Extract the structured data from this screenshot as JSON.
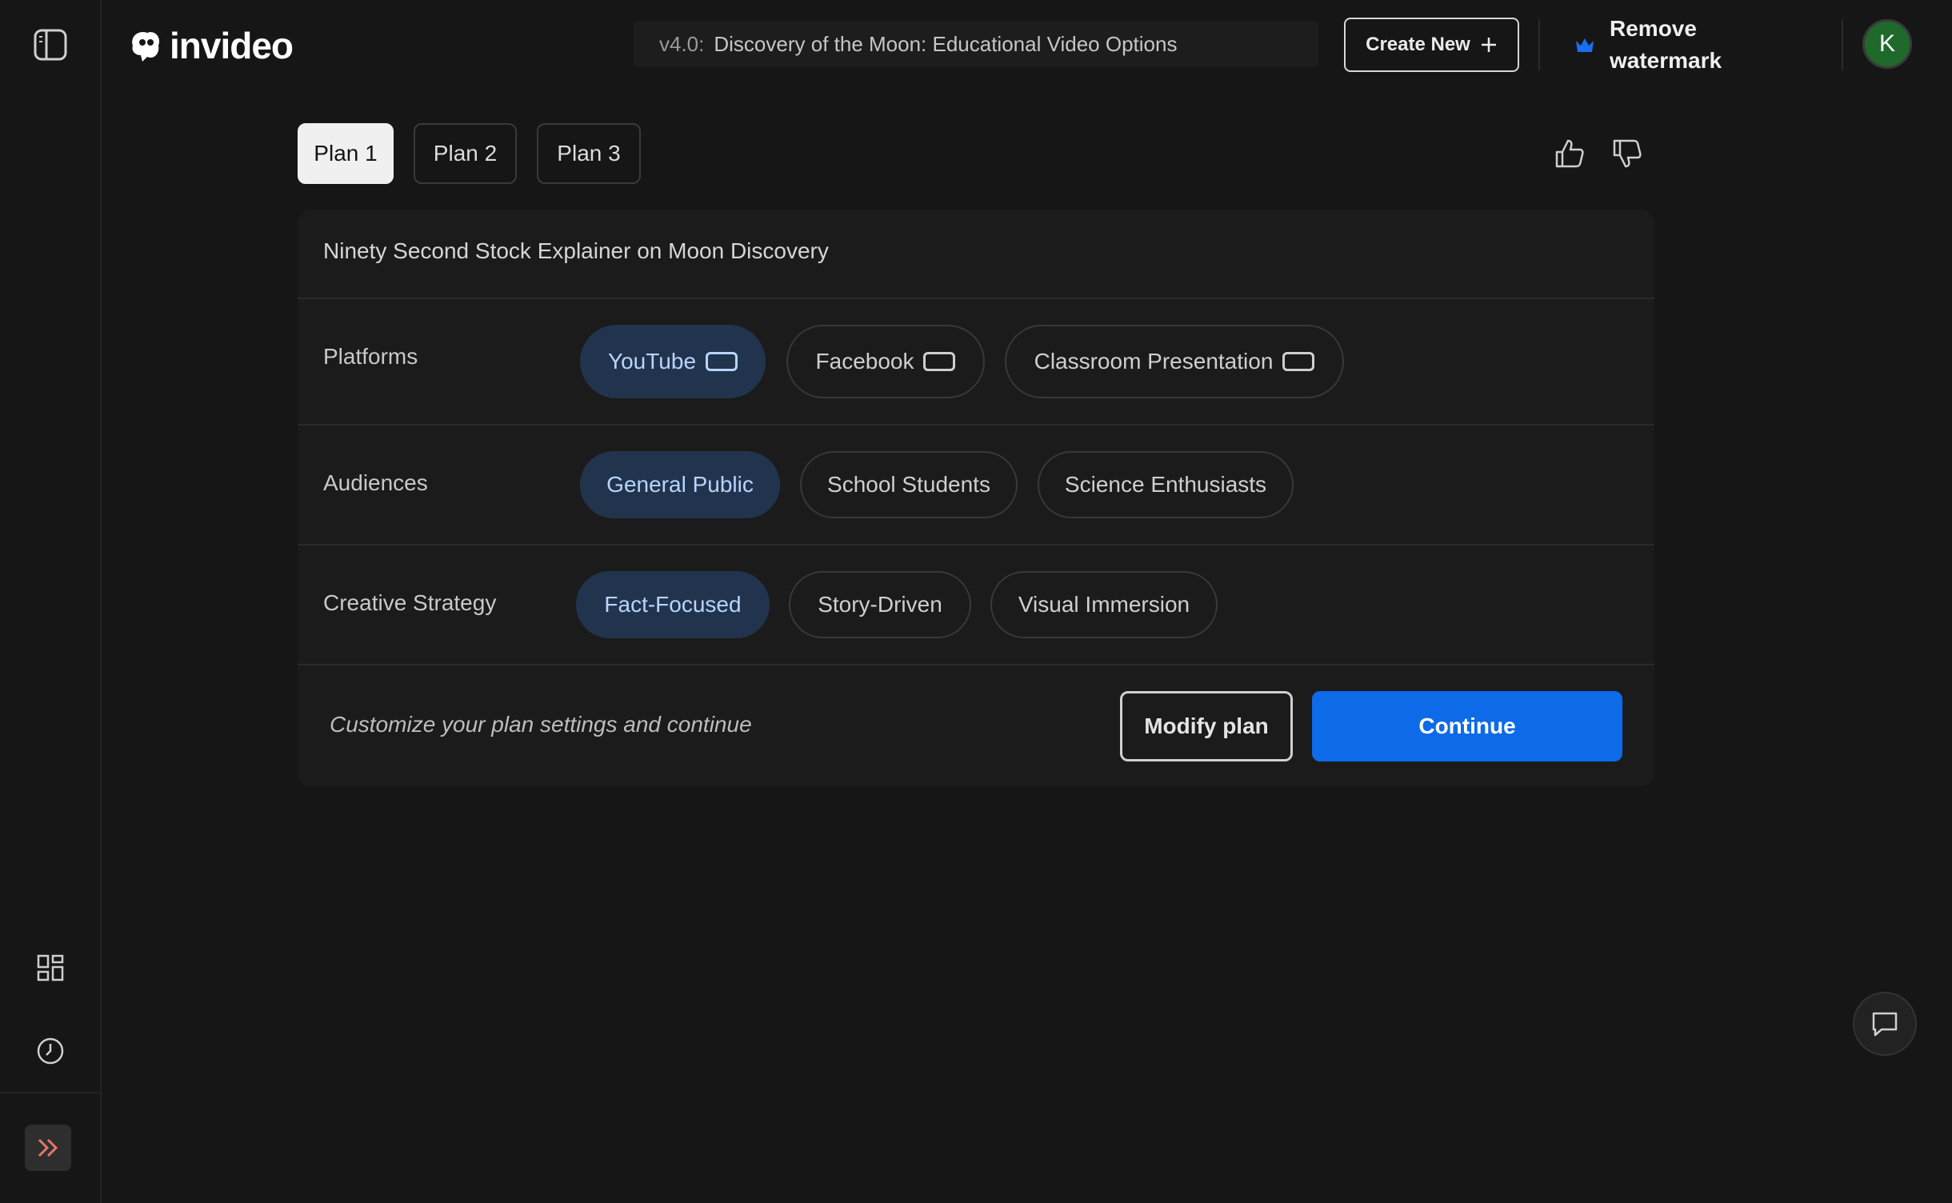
{
  "header": {
    "logo_text": "invideo",
    "project_version": "v4.0:",
    "project_title": "Discovery of the Moon: Educational Video Options",
    "create_new_label": "Create New",
    "remove_watermark_label": "Remove watermark",
    "avatar_initial": "K",
    "colors": {
      "crown": "#1a6ff0",
      "avatar_bg": "#1f6a2a"
    }
  },
  "sidebar": {
    "icons": [
      "sidebar-toggle-icon",
      "grid-icon",
      "history-clock-icon",
      "double-chevron-right-icon"
    ]
  },
  "plan_tabs": [
    {
      "label": "Plan 1",
      "active": true
    },
    {
      "label": "Plan 2",
      "active": false
    },
    {
      "label": "Plan 3",
      "active": false
    }
  ],
  "feedback": {
    "icons": [
      "thumbs-up-icon",
      "thumbs-down-icon"
    ]
  },
  "plan": {
    "title": "Ninety Second Stock Explainer on Moon Discovery",
    "platforms": {
      "label": "Platforms",
      "options": [
        {
          "label": "YouTube",
          "selected": true
        },
        {
          "label": "Facebook",
          "selected": false
        },
        {
          "label": "Classroom Presentation",
          "selected": false
        }
      ]
    },
    "audiences": {
      "label": "Audiences",
      "options": [
        {
          "label": "General Public",
          "selected": true
        },
        {
          "label": "School Students",
          "selected": false
        },
        {
          "label": "Science Enthusiasts",
          "selected": false
        }
      ]
    },
    "creative_strategy": {
      "label": "Creative Strategy",
      "options": [
        {
          "label": "Fact-Focused",
          "selected": true
        },
        {
          "label": "Story-Driven",
          "selected": false
        },
        {
          "label": "Visual Immersion",
          "selected": false
        }
      ]
    },
    "hint": "Customize your plan settings and continue",
    "modify_label": "Modify plan",
    "continue_label": "Continue",
    "colors": {
      "accent": "#0d6ae8",
      "selected_chip_bg": "#22344d",
      "selected_chip_text": "#b8d4ff"
    }
  },
  "chat": {
    "icon": "chat-bubble-icon"
  }
}
